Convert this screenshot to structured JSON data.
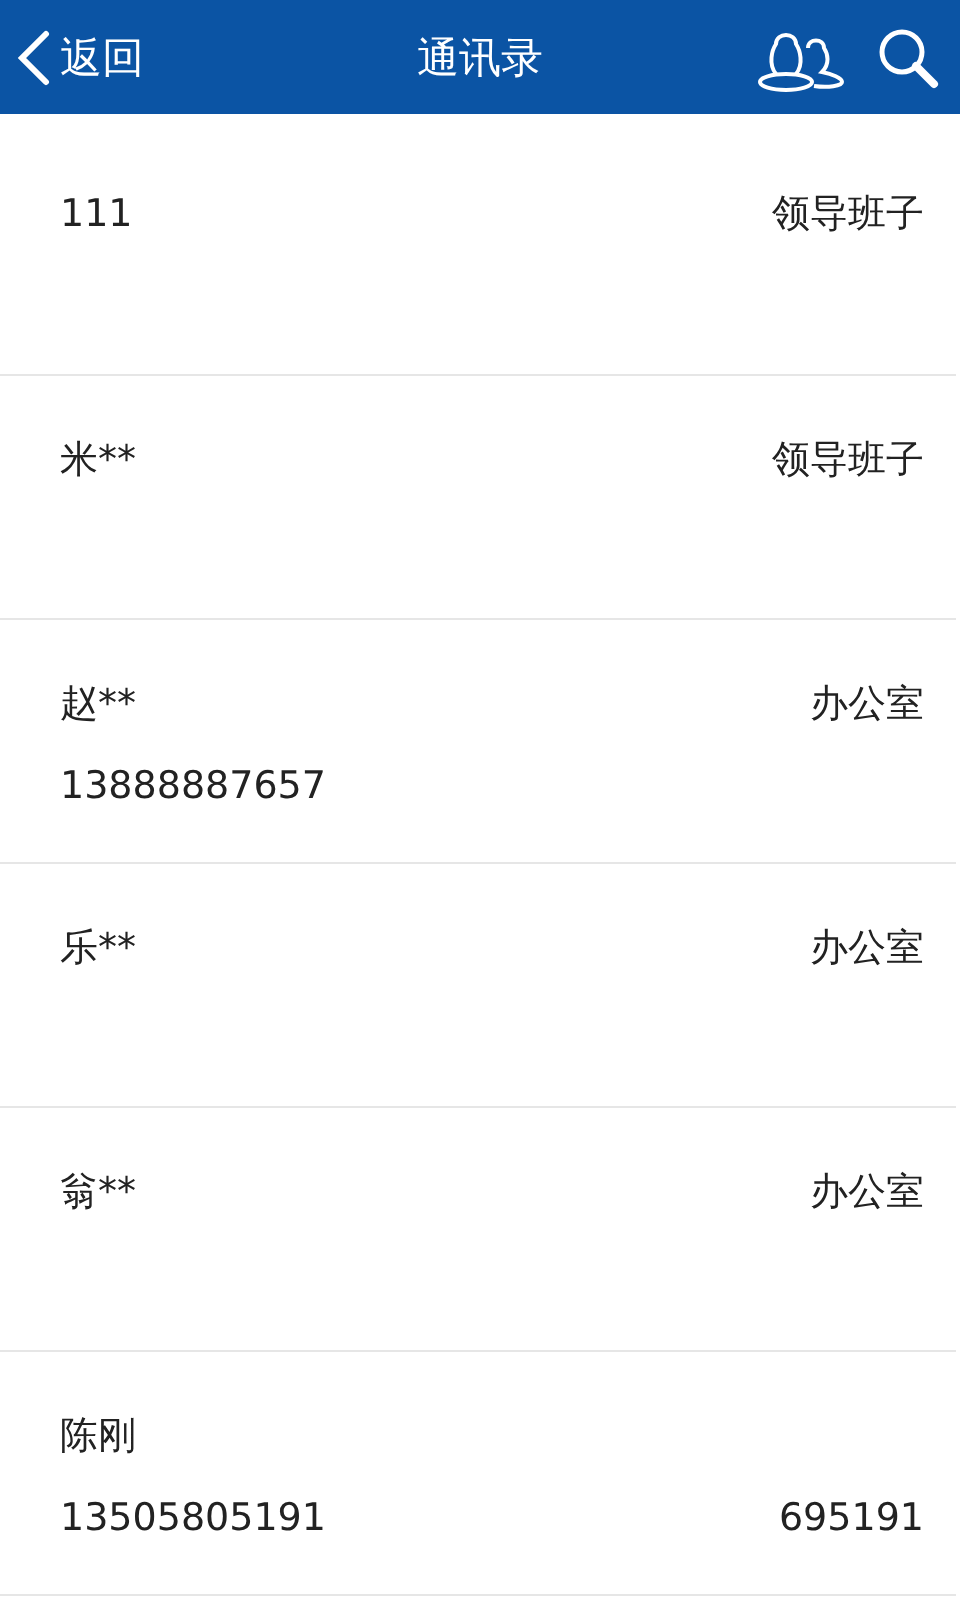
{
  "header": {
    "back": "返回",
    "title": "通讯录"
  },
  "contacts": [
    {
      "name": "111",
      "department": "领导班子"
    },
    {
      "name": "米**",
      "department": "领导班子"
    },
    {
      "name": "赵**",
      "department": "办公室",
      "phone": "13888887657"
    },
    {
      "name": "乐**",
      "department": "办公室"
    },
    {
      "name": "翁**",
      "department": "办公室"
    },
    {
      "name": "陈刚",
      "phone": "13505805191",
      "extension": "695191"
    }
  ]
}
